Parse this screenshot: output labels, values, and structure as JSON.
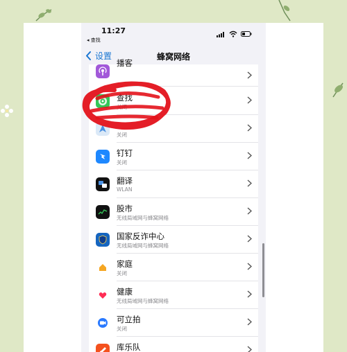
{
  "status_bar": {
    "time": "11:27",
    "back_app": "◂ 查找"
  },
  "nav": {
    "back_label": "设置",
    "title": "蜂窝网络"
  },
  "apps": [
    {
      "name": "播客",
      "sub": "",
      "icon": "podcasts-icon",
      "color": "#a259d9"
    },
    {
      "name": "查找",
      "sub": "关闭",
      "icon": "find-my-icon",
      "color": "#34c759"
    },
    {
      "name": "",
      "sub": "关闭",
      "icon": "maps-icon",
      "color": "#4a90e2"
    },
    {
      "name": "钉钉",
      "sub": "关闭",
      "icon": "dingtalk-icon",
      "color": "#1e88ff"
    },
    {
      "name": "翻译",
      "sub": "WLAN",
      "icon": "translate-icon",
      "color": "#111111"
    },
    {
      "name": "股市",
      "sub": "无线局域网与蜂窝网络",
      "icon": "stocks-icon",
      "color": "#111111"
    },
    {
      "name": "国家反诈中心",
      "sub": "无线局域网与蜂窝网络",
      "icon": "anti-fraud-icon",
      "color": "#1565c0"
    },
    {
      "name": "家庭",
      "sub": "关闭",
      "icon": "home-icon",
      "color": "#ffffff"
    },
    {
      "name": "健康",
      "sub": "无线局域网与蜂窝网络",
      "icon": "health-icon",
      "color": "#ffffff"
    },
    {
      "name": "可立拍",
      "sub": "关闭",
      "icon": "clips-icon",
      "color": "#2979ff"
    },
    {
      "name": "库乐队",
      "sub": "",
      "icon": "garageband-icon",
      "color": "#f4511e"
    }
  ],
  "colors": {
    "accent": "#1976d2",
    "scribble": "#e3121b",
    "background": "#dfe8c6"
  }
}
